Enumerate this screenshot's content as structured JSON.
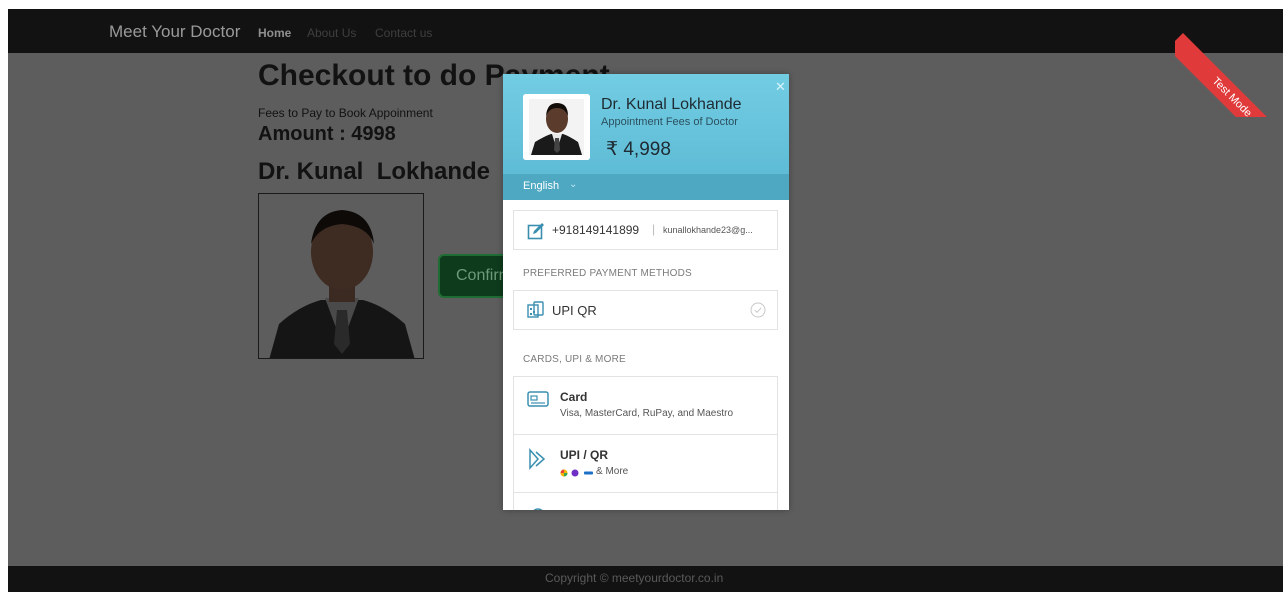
{
  "navbar": {
    "brand": "Meet Your Doctor",
    "links": [
      "Home",
      "About Us",
      "Contact us"
    ]
  },
  "page": {
    "title": "Checkout to do Payment",
    "fees_label": "Fees to Pay to Book Appoinment",
    "amount": "Amount : 4998",
    "doctor_name": "Dr. Kunal  Lokhande",
    "confirm_button": "Confirm"
  },
  "footer": {
    "copyright": "Copyright © meetyourdoctor.co.in"
  },
  "ribbon": {
    "label": "Test Mode",
    "color": "#e03a3a"
  },
  "checkout": {
    "merchant_name": "Dr. Kunal Lokhande",
    "description": "Appointment Fees of Doctor",
    "amount": "₹ 4,998",
    "language": "English",
    "contact": {
      "phone": "+918149141899",
      "separator": "|",
      "email": "kunallokhande23@g..."
    },
    "preferred_label": "PREFERRED PAYMENT METHODS",
    "preferred": [
      {
        "label": "UPI QR",
        "icon": "qr-icon"
      }
    ],
    "more_label": "CARDS, UPI & MORE",
    "methods": [
      {
        "title": "Card",
        "subtitle": "Visa, MasterCard, RuPay, and Maestro",
        "icon": "card-icon"
      },
      {
        "title": "UPI / QR",
        "subtitle": "& More",
        "icon": "upi-icon"
      }
    ],
    "colors": {
      "header": "#72cde3",
      "accent": "#4ea8c2"
    }
  }
}
